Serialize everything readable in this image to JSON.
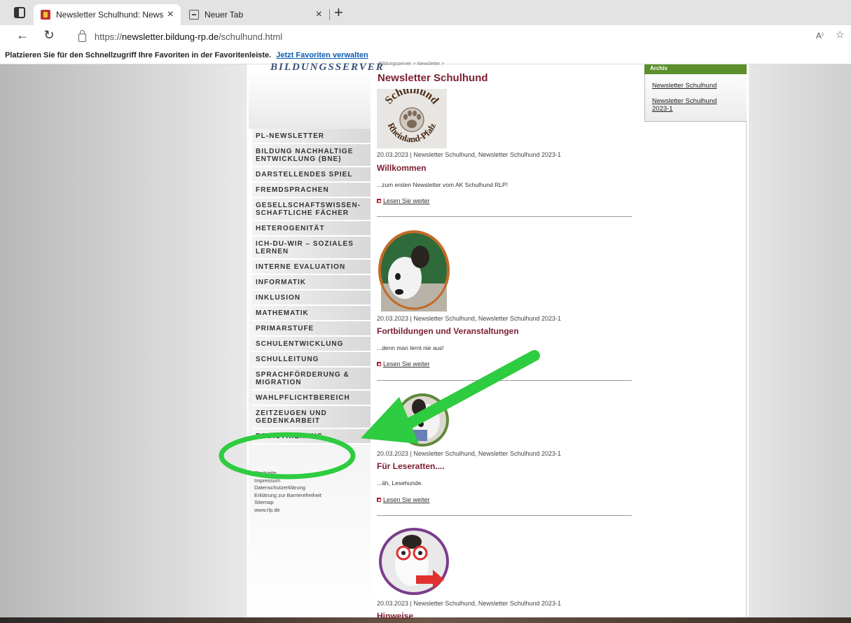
{
  "browser": {
    "tabs": [
      {
        "title": "Newsletter Schulhund: Newslette",
        "close": "×"
      },
      {
        "title": "Neuer Tab",
        "close": "×"
      }
    ],
    "new_tab": "+",
    "url": {
      "scheme": "https://",
      "host": "newsletter.bildung-rp.de",
      "path": "/schulhund.html"
    },
    "read_aloud": "A⁾",
    "favorites_bar_text": "Platzieren Sie für den Schnellzugriff Ihre Favoriten in der Favoritenleiste.",
    "favorites_bar_link": "Jetzt Favoriten verwalten"
  },
  "site": {
    "logo": "BILDUNGSSERVER",
    "breadcrumb": "Bildungsserver > Newsletter >",
    "title": "Newsletter Schulhund",
    "nav": [
      "PL-NEWSLETTER",
      "BILDUNG NACHHALTIGE ENTWICKLUNG (BNE)",
      "DARSTELLENDES SPIEL",
      "FREMDSPRACHEN",
      "GESELLSCHAFTSWISSEN-SCHAFTLICHE FÄCHER",
      "HETEROGENITÄT",
      "ICH-DU-WIR – SOZIALES LERNEN",
      "INTERNE EVALUATION",
      "INFORMATIK",
      "INKLUSION",
      "MATHEMATIK",
      "PRIMARSTUFE",
      "SCHULENTWICKLUNG",
      "SCHULLEITUNG",
      "SPRACHFÖRDERUNG & MIGRATION",
      "WAHLPFLICHTBEREICH",
      "ZEITZEUGEN UND GEDENKARBEIT",
      "REGISTRIERUNG"
    ],
    "footer_links": [
      "Startseite",
      "Impressum",
      "Datenschutzerklärung",
      "Erklärung zur Barrierefreiheit",
      "Sitemap",
      "www.rlp.de"
    ],
    "logo_image_text_top": "Schulhund",
    "logo_image_text_bottom": "Rheinland-Pfalz",
    "archive": {
      "heading": "Archiv",
      "links": [
        "Newsletter Schulhund",
        "Newsletter Schulhund 2023-1"
      ]
    },
    "entries": [
      {
        "meta": "20.03.2023 | Newsletter Schulhund, Newsletter Schulhund 2023-1",
        "title": "Willkommen",
        "teaser": "...zum ersten Newsletter vom AK Schulhund RLP!",
        "more": "Lesen Sie weiter"
      },
      {
        "meta": "20.03.2023 | Newsletter Schulhund, Newsletter Schulhund 2023-1",
        "title": "Fortbildungen und Veranstaltungen",
        "teaser": "...denn man lernt nie aus!",
        "more": "Lesen Sie weiter"
      },
      {
        "meta": "20.03.2023 | Newsletter Schulhund, Newsletter Schulhund 2023-1",
        "title": "Für Leseratten....",
        "teaser": "...äh, Lesehunde.",
        "more": "Lesen Sie weiter"
      },
      {
        "meta": "20.03.2023 | Newsletter Schulhund, Newsletter Schulhund 2023-1",
        "title": "Hinweise",
        "teaser": "",
        "more": ""
      }
    ]
  },
  "annotation_color": "#2ecc40"
}
